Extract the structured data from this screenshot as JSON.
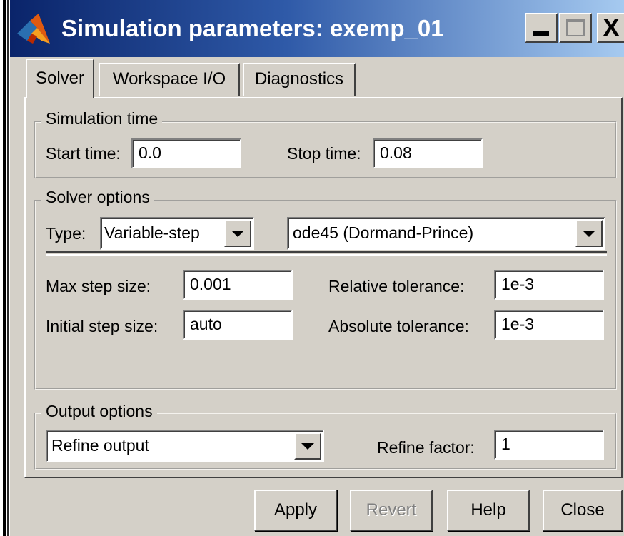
{
  "window": {
    "title": "Simulation parameters: exemp_01",
    "controls": {
      "minimize": "minimize-icon",
      "maximize": "maximize-icon",
      "close": "X"
    }
  },
  "tabs": [
    {
      "label": "Solver",
      "active": true
    },
    {
      "label": "Workspace I/O",
      "active": false
    },
    {
      "label": "Diagnostics",
      "active": false
    }
  ],
  "simulation_time": {
    "group_label": "Simulation time",
    "start_label": "Start time:",
    "start_value": "0.0",
    "stop_label": "Stop time:",
    "stop_value": "0.08"
  },
  "solver_options": {
    "group_label": "Solver options",
    "type_label": "Type:",
    "type_value": "Variable-step",
    "solver_value": "ode45 (Dormand-Prince)",
    "max_step_label": "Max step size:",
    "max_step_value": "0.001",
    "initial_step_label": "Initial step size:",
    "initial_step_value": "auto",
    "rel_tol_label": "Relative tolerance:",
    "rel_tol_value": "1e-3",
    "abs_tol_label": "Absolute tolerance:",
    "abs_tol_value": "1e-3"
  },
  "output_options": {
    "group_label": "Output options",
    "mode_value": "Refine output",
    "refine_label": "Refine factor:",
    "refine_value": "1"
  },
  "buttons": {
    "apply": "Apply",
    "revert": "Revert",
    "help": "Help",
    "close": "Close"
  },
  "colors": {
    "titlebar_start": "#0a246a",
    "titlebar_end": "#a6caf0",
    "face": "#d4d0c8",
    "disabled_text": "#808080"
  }
}
